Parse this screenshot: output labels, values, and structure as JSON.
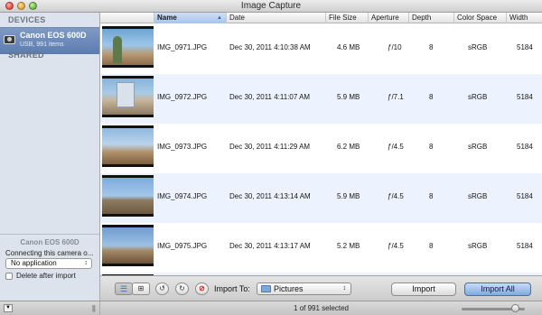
{
  "window": {
    "title": "Image Capture"
  },
  "sidebar": {
    "devices_header": "DEVICES",
    "shared_header": "SHARED",
    "device": {
      "name": "Canon EOS 600D",
      "subtitle": "USB, 991 items",
      "icon": "camera-icon"
    },
    "camera_label": "Canon EOS 600D",
    "connecting_text": "Connecting this camera o...",
    "app_select": {
      "value": "No application"
    },
    "delete_after_import": {
      "label": "Delete after import",
      "checked": false
    }
  },
  "table": {
    "columns": [
      "Name",
      "Date",
      "File Size",
      "Aperture",
      "Depth",
      "Color Space",
      "Width"
    ],
    "sorted_column": "Name",
    "rows": [
      {
        "name": "IMG_0971.JPG",
        "date": "Dec 30, 2011 4:10:38 AM",
        "size": "4.6 MB",
        "aperture": "ƒ/10",
        "depth": "8",
        "color_space": "sRGB",
        "width": "5184"
      },
      {
        "name": "IMG_0972.JPG",
        "date": "Dec 30, 2011 4:11:07 AM",
        "size": "5.9 MB",
        "aperture": "ƒ/7.1",
        "depth": "8",
        "color_space": "sRGB",
        "width": "5184"
      },
      {
        "name": "IMG_0973.JPG",
        "date": "Dec 30, 2011 4:11:29 AM",
        "size": "6.2 MB",
        "aperture": "ƒ/4.5",
        "depth": "8",
        "color_space": "sRGB",
        "width": "5184"
      },
      {
        "name": "IMG_0974.JPG",
        "date": "Dec 30, 2011 4:13:14 AM",
        "size": "5.9 MB",
        "aperture": "ƒ/4.5",
        "depth": "8",
        "color_space": "sRGB",
        "width": "5184"
      },
      {
        "name": "IMG_0975.JPG",
        "date": "Dec 30, 2011 4:13:17 AM",
        "size": "5.2 MB",
        "aperture": "ƒ/4.5",
        "depth": "8",
        "color_space": "sRGB",
        "width": "5184"
      }
    ]
  },
  "toolbar": {
    "list_view_icon": "list-view-icon",
    "grid_view_icon": "grid-view-icon",
    "rotate_left_icon": "rotate-left-icon",
    "rotate_right_icon": "rotate-right-icon",
    "delete_icon": "delete-icon",
    "import_to_label": "Import To:",
    "import_destination": "Pictures",
    "import_button": "Import",
    "import_all_button": "Import All"
  },
  "status": {
    "text": "1 of 991 selected",
    "thumbnail_size": 0.85
  }
}
